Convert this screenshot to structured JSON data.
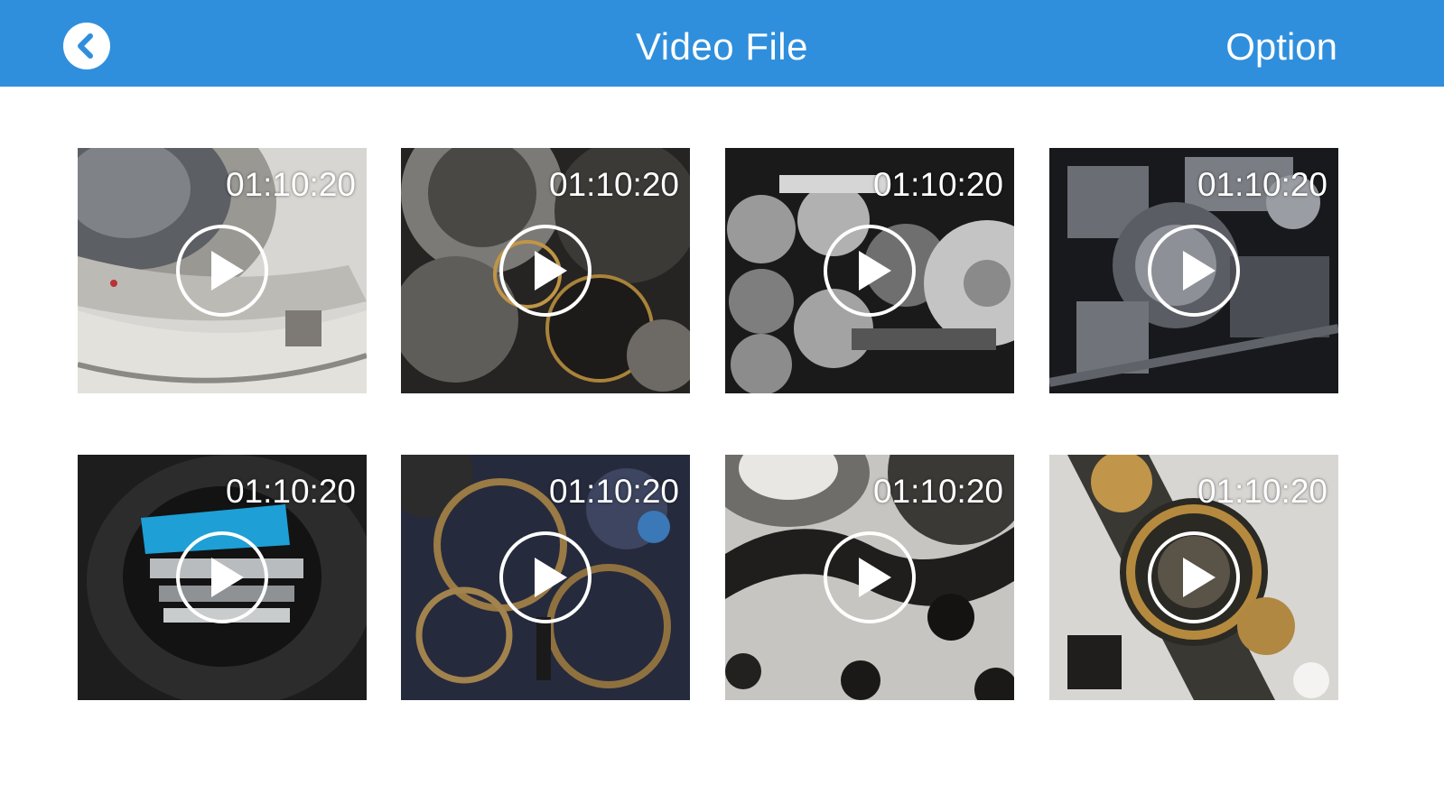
{
  "header": {
    "title": "Video File",
    "option_label": "Option",
    "back_icon": "chevron-left-icon",
    "color": "#2f8fdc"
  },
  "videos": [
    {
      "duration": "01:10:20",
      "thumbnail": "camera lens closeup"
    },
    {
      "duration": "01:10:20",
      "thumbnail": "watch movement gears"
    },
    {
      "duration": "01:10:20",
      "thumbnail": "machine gears black and white"
    },
    {
      "duration": "01:10:20",
      "thumbnail": "grey clockwork"
    },
    {
      "duration": "01:10:20",
      "thumbnail": "camera lens with blue reflection"
    },
    {
      "duration": "01:10:20",
      "thumbnail": "brass gears"
    },
    {
      "duration": "01:10:20",
      "thumbnail": "steel cogwheels"
    },
    {
      "duration": "01:10:20",
      "thumbnail": "watch mechanism gold"
    }
  ]
}
